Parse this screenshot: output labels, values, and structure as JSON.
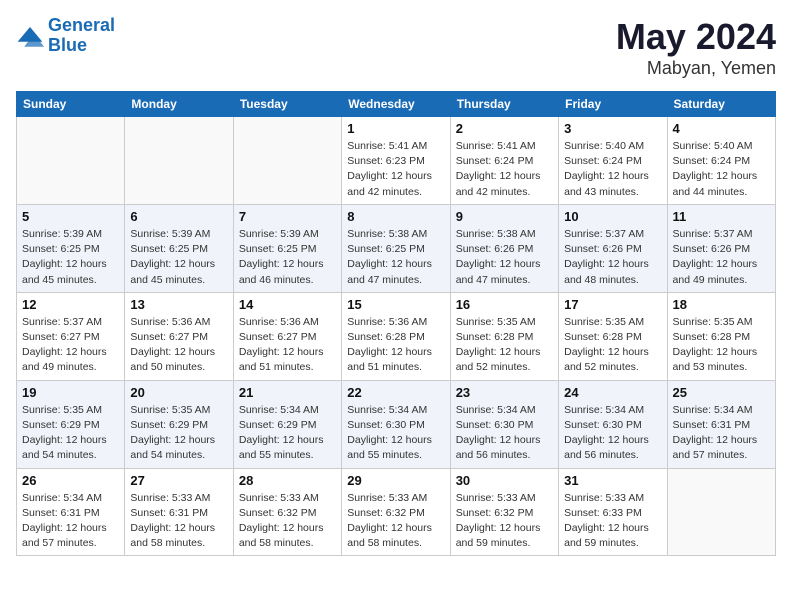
{
  "header": {
    "logo_line1": "General",
    "logo_line2": "Blue",
    "month": "May 2024",
    "location": "Mabyan, Yemen"
  },
  "weekdays": [
    "Sunday",
    "Monday",
    "Tuesday",
    "Wednesday",
    "Thursday",
    "Friday",
    "Saturday"
  ],
  "weeks": [
    [
      {
        "day": "",
        "info": ""
      },
      {
        "day": "",
        "info": ""
      },
      {
        "day": "",
        "info": ""
      },
      {
        "day": "1",
        "info": "Sunrise: 5:41 AM\nSunset: 6:23 PM\nDaylight: 12 hours\nand 42 minutes."
      },
      {
        "day": "2",
        "info": "Sunrise: 5:41 AM\nSunset: 6:24 PM\nDaylight: 12 hours\nand 42 minutes."
      },
      {
        "day": "3",
        "info": "Sunrise: 5:40 AM\nSunset: 6:24 PM\nDaylight: 12 hours\nand 43 minutes."
      },
      {
        "day": "4",
        "info": "Sunrise: 5:40 AM\nSunset: 6:24 PM\nDaylight: 12 hours\nand 44 minutes."
      }
    ],
    [
      {
        "day": "5",
        "info": "Sunrise: 5:39 AM\nSunset: 6:25 PM\nDaylight: 12 hours\nand 45 minutes."
      },
      {
        "day": "6",
        "info": "Sunrise: 5:39 AM\nSunset: 6:25 PM\nDaylight: 12 hours\nand 45 minutes."
      },
      {
        "day": "7",
        "info": "Sunrise: 5:39 AM\nSunset: 6:25 PM\nDaylight: 12 hours\nand 46 minutes."
      },
      {
        "day": "8",
        "info": "Sunrise: 5:38 AM\nSunset: 6:25 PM\nDaylight: 12 hours\nand 47 minutes."
      },
      {
        "day": "9",
        "info": "Sunrise: 5:38 AM\nSunset: 6:26 PM\nDaylight: 12 hours\nand 47 minutes."
      },
      {
        "day": "10",
        "info": "Sunrise: 5:37 AM\nSunset: 6:26 PM\nDaylight: 12 hours\nand 48 minutes."
      },
      {
        "day": "11",
        "info": "Sunrise: 5:37 AM\nSunset: 6:26 PM\nDaylight: 12 hours\nand 49 minutes."
      }
    ],
    [
      {
        "day": "12",
        "info": "Sunrise: 5:37 AM\nSunset: 6:27 PM\nDaylight: 12 hours\nand 49 minutes."
      },
      {
        "day": "13",
        "info": "Sunrise: 5:36 AM\nSunset: 6:27 PM\nDaylight: 12 hours\nand 50 minutes."
      },
      {
        "day": "14",
        "info": "Sunrise: 5:36 AM\nSunset: 6:27 PM\nDaylight: 12 hours\nand 51 minutes."
      },
      {
        "day": "15",
        "info": "Sunrise: 5:36 AM\nSunset: 6:28 PM\nDaylight: 12 hours\nand 51 minutes."
      },
      {
        "day": "16",
        "info": "Sunrise: 5:35 AM\nSunset: 6:28 PM\nDaylight: 12 hours\nand 52 minutes."
      },
      {
        "day": "17",
        "info": "Sunrise: 5:35 AM\nSunset: 6:28 PM\nDaylight: 12 hours\nand 52 minutes."
      },
      {
        "day": "18",
        "info": "Sunrise: 5:35 AM\nSunset: 6:28 PM\nDaylight: 12 hours\nand 53 minutes."
      }
    ],
    [
      {
        "day": "19",
        "info": "Sunrise: 5:35 AM\nSunset: 6:29 PM\nDaylight: 12 hours\nand 54 minutes."
      },
      {
        "day": "20",
        "info": "Sunrise: 5:35 AM\nSunset: 6:29 PM\nDaylight: 12 hours\nand 54 minutes."
      },
      {
        "day": "21",
        "info": "Sunrise: 5:34 AM\nSunset: 6:29 PM\nDaylight: 12 hours\nand 55 minutes."
      },
      {
        "day": "22",
        "info": "Sunrise: 5:34 AM\nSunset: 6:30 PM\nDaylight: 12 hours\nand 55 minutes."
      },
      {
        "day": "23",
        "info": "Sunrise: 5:34 AM\nSunset: 6:30 PM\nDaylight: 12 hours\nand 56 minutes."
      },
      {
        "day": "24",
        "info": "Sunrise: 5:34 AM\nSunset: 6:30 PM\nDaylight: 12 hours\nand 56 minutes."
      },
      {
        "day": "25",
        "info": "Sunrise: 5:34 AM\nSunset: 6:31 PM\nDaylight: 12 hours\nand 57 minutes."
      }
    ],
    [
      {
        "day": "26",
        "info": "Sunrise: 5:34 AM\nSunset: 6:31 PM\nDaylight: 12 hours\nand 57 minutes."
      },
      {
        "day": "27",
        "info": "Sunrise: 5:33 AM\nSunset: 6:31 PM\nDaylight: 12 hours\nand 58 minutes."
      },
      {
        "day": "28",
        "info": "Sunrise: 5:33 AM\nSunset: 6:32 PM\nDaylight: 12 hours\nand 58 minutes."
      },
      {
        "day": "29",
        "info": "Sunrise: 5:33 AM\nSunset: 6:32 PM\nDaylight: 12 hours\nand 58 minutes."
      },
      {
        "day": "30",
        "info": "Sunrise: 5:33 AM\nSunset: 6:32 PM\nDaylight: 12 hours\nand 59 minutes."
      },
      {
        "day": "31",
        "info": "Sunrise: 5:33 AM\nSunset: 6:33 PM\nDaylight: 12 hours\nand 59 minutes."
      },
      {
        "day": "",
        "info": ""
      }
    ]
  ]
}
